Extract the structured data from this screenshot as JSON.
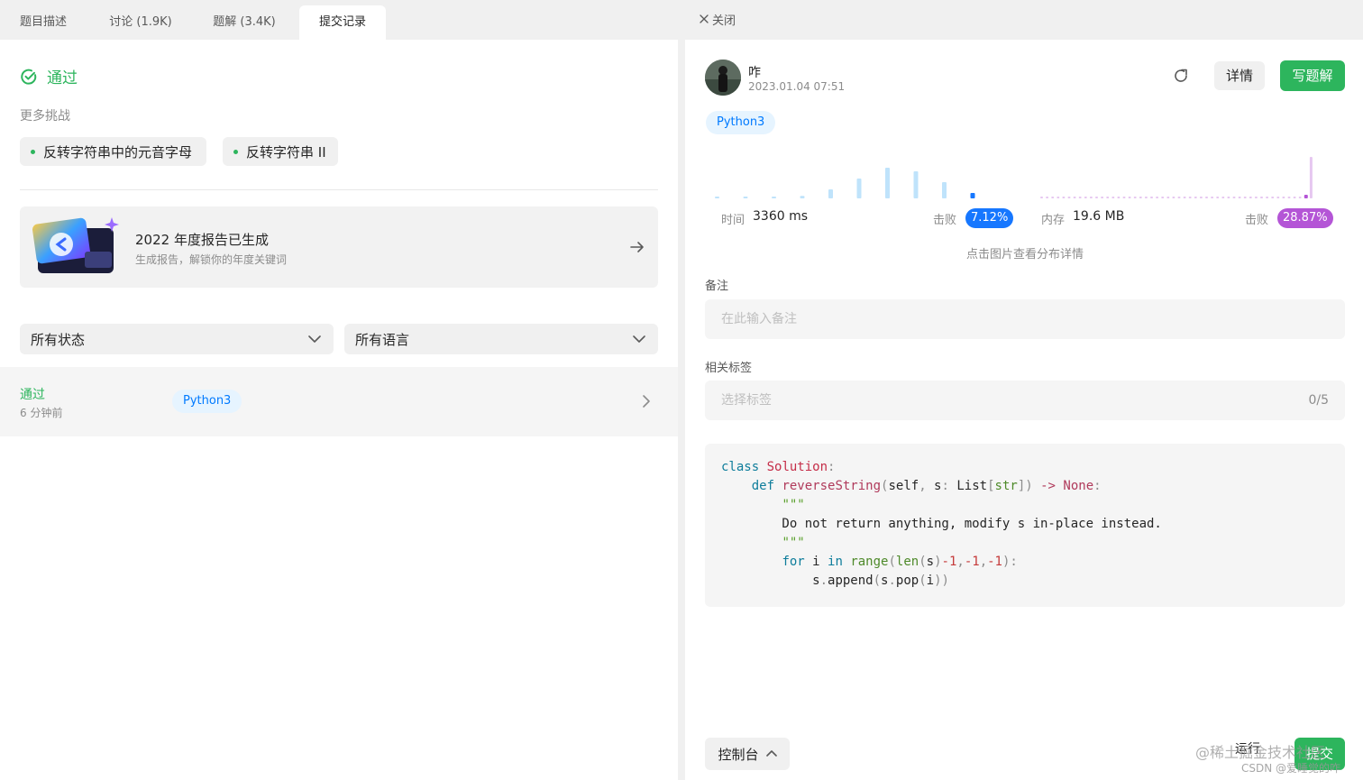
{
  "tabs": [
    {
      "label": "题目描述",
      "active": false
    },
    {
      "label": "讨论 (1.9K)",
      "active": false
    },
    {
      "label": "题解 (3.4K)",
      "active": false
    },
    {
      "label": "提交记录",
      "active": true
    }
  ],
  "left": {
    "status_title": "通过",
    "more_label": "更多挑战",
    "challenges": [
      "反转字符串中的元音字母",
      "反转字符串 II"
    ],
    "banner": {
      "title": "2022 年度报告已生成",
      "subtitle": "生成报告，解锁你的年度关键词"
    },
    "filters": {
      "status": "所有状态",
      "language": "所有语言"
    },
    "submissions": [
      {
        "status": "通过",
        "time": "6 分钟前",
        "language": "Python3"
      }
    ]
  },
  "right": {
    "close_label": "关闭",
    "user": {
      "name": "咋",
      "date": "2023.01.04 07:51"
    },
    "detail_label": "详情",
    "write_label": "写题解",
    "language": "Python3",
    "stats": {
      "time_label": "时间",
      "time_value": "3360 ms",
      "time_beat_label": "击败",
      "time_beat": "7.12%",
      "memory_label": "内存",
      "memory_value": "19.6 MB",
      "memory_beat_label": "击败",
      "memory_beat": "28.87%",
      "hint": "点击图片查看分布详情"
    },
    "note_label": "备注",
    "note_placeholder": "在此输入备注",
    "tags_label": "相关标签",
    "tags_placeholder": "选择标签",
    "tags_count": "0/5",
    "console_label": "控制台",
    "run_label": "运行",
    "submit_label": "提交",
    "watermark": "@稀土掘金技术社区",
    "watermark2": "CSDN @爱睡觉的咋"
  },
  "chart_data": {
    "type": "bar",
    "time_distribution": [
      0.05,
      0.05,
      0.05,
      0.07,
      0.25,
      0.55,
      0.85,
      0.75,
      0.45,
      0.15
    ],
    "time_highlight_index": 9,
    "memory_highlight": "last",
    "colors": {
      "time": "#bfe3fb",
      "time_highlight": "#1677ff",
      "memory": "#e6c7f0",
      "memory_highlight": "#b455d6"
    }
  },
  "colors": {
    "accent": "#2db55d",
    "blue": "#1677ff",
    "purple": "#b455d6"
  }
}
